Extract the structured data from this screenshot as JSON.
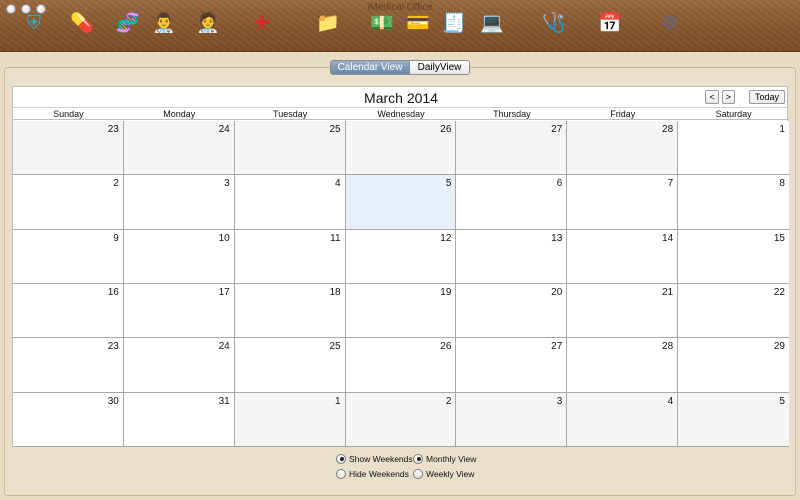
{
  "window": {
    "title": "iMedical Office"
  },
  "toolbar": {
    "items": [
      {
        "name": "shield-icon",
        "glyph": "⛨",
        "color": "#3aa6c9"
      },
      {
        "name": "pills-icon",
        "glyph": "💊",
        "color": "#d23a2a"
      },
      {
        "name": "dna-icon",
        "glyph": "🧬",
        "color": "#5fa9d6"
      },
      {
        "name": "doctor-icon",
        "glyph": "👨‍⚕️",
        "color": "#5b8fc7"
      },
      {
        "name": "nurse-icon",
        "glyph": "🧑‍⚕️",
        "color": "#4a9a6a"
      },
      {
        "name": "medical-cross-icon",
        "glyph": "✚",
        "color": "#d42a2a"
      },
      {
        "name": "folder-icon",
        "glyph": "📁",
        "color": "#8a78c2"
      },
      {
        "name": "cash-register-icon",
        "glyph": "💵",
        "color": "#5a9a3a"
      },
      {
        "name": "credit-card-icon",
        "glyph": "💳",
        "color": "#2a4a9a"
      },
      {
        "name": "medicine-box-icon",
        "glyph": "🧾",
        "color": "#c83030"
      },
      {
        "name": "laptop-icon",
        "glyph": "💻",
        "color": "#4a6ac8"
      },
      {
        "name": "patient-icon",
        "glyph": "🩺",
        "color": "#c8442a"
      },
      {
        "name": "calendar-check-icon",
        "glyph": "📅",
        "color": "#2a7ac8"
      },
      {
        "name": "gear-icon",
        "glyph": "⚙",
        "color": "#5a6a8a"
      }
    ]
  },
  "view_toggle": {
    "calendar_label": "Calendar View",
    "daily_label": "DailyView",
    "selected": "calendar"
  },
  "calendar": {
    "title": "March 2014",
    "prev_label": "<",
    "next_label": ">",
    "today_label": "Today",
    "day_headers": [
      "Sunday",
      "Monday",
      "Tuesday",
      "Wednesday",
      "Thursday",
      "Friday",
      "Saturday"
    ],
    "days": [
      {
        "n": "23",
        "other": true
      },
      {
        "n": "24",
        "other": true
      },
      {
        "n": "25",
        "other": true
      },
      {
        "n": "26",
        "other": true
      },
      {
        "n": "27",
        "other": true
      },
      {
        "n": "28",
        "other": true
      },
      {
        "n": "1"
      },
      {
        "n": "2"
      },
      {
        "n": "3"
      },
      {
        "n": "4"
      },
      {
        "n": "5",
        "today": true
      },
      {
        "n": "6"
      },
      {
        "n": "7"
      },
      {
        "n": "8"
      },
      {
        "n": "9"
      },
      {
        "n": "10"
      },
      {
        "n": "11"
      },
      {
        "n": "12"
      },
      {
        "n": "13"
      },
      {
        "n": "14"
      },
      {
        "n": "15"
      },
      {
        "n": "16"
      },
      {
        "n": "17"
      },
      {
        "n": "18"
      },
      {
        "n": "19"
      },
      {
        "n": "20"
      },
      {
        "n": "21"
      },
      {
        "n": "22"
      },
      {
        "n": "23"
      },
      {
        "n": "24"
      },
      {
        "n": "25"
      },
      {
        "n": "26"
      },
      {
        "n": "27"
      },
      {
        "n": "28"
      },
      {
        "n": "29"
      },
      {
        "n": "30"
      },
      {
        "n": "31"
      },
      {
        "n": "1",
        "other": true
      },
      {
        "n": "2",
        "other": true
      },
      {
        "n": "3",
        "other": true
      },
      {
        "n": "4",
        "other": true
      },
      {
        "n": "5",
        "other": true
      }
    ]
  },
  "options": {
    "show_weekends": {
      "label": "Show Weekends",
      "checked": true
    },
    "hide_weekends": {
      "label": "Hide Weekends",
      "checked": false
    },
    "monthly_view": {
      "label": "Monthly View",
      "checked": true
    },
    "weekly_view": {
      "label": "Weekly View",
      "checked": false
    }
  }
}
